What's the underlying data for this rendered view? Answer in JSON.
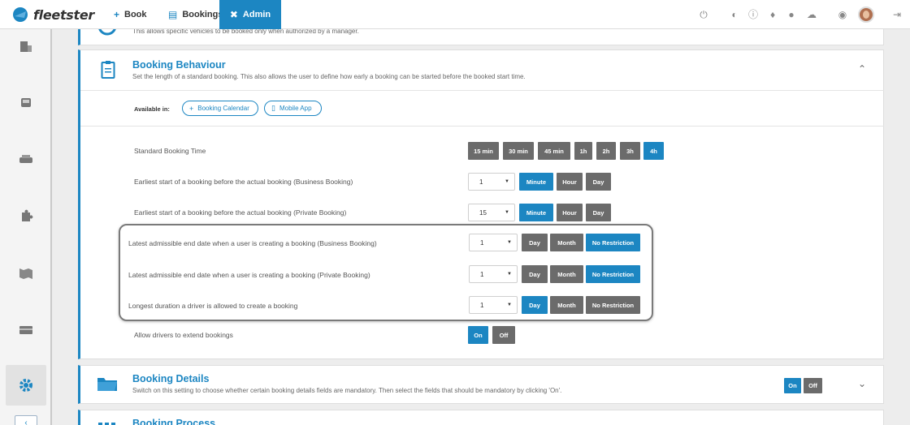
{
  "app": {
    "name": "fleetster",
    "brand_color": "#1c86c2"
  },
  "topnav": {
    "book": "Book",
    "bookings": "Bookings",
    "admin": "Admin"
  },
  "top_card": {
    "desc": "This allows specific vehicles to be booked only when authorized by a manager."
  },
  "booking_behaviour": {
    "title": "Booking Behaviour",
    "desc": "Set the length of a standard booking. This also allows the user to define how early a booking can be started before the booked start time.",
    "available_in_label": "Available in:",
    "available_in": [
      "Booking Calendar",
      "Mobile App"
    ],
    "rows": {
      "standard_time": {
        "label": "Standard Booking Time",
        "options": [
          "15 min",
          "30 min",
          "45 min",
          "1h",
          "2h",
          "3h",
          "4h"
        ],
        "selected": "4h"
      },
      "earliest_business": {
        "label": "Earliest start of a booking before the actual booking (Business Booking)",
        "value": "1",
        "units": [
          "Minute",
          "Hour",
          "Day"
        ],
        "selected": "Minute"
      },
      "earliest_private": {
        "label": "Earliest start of a booking before the actual booking (Private Booking)",
        "value": "15",
        "units": [
          "Minute",
          "Hour",
          "Day"
        ],
        "selected": "Minute"
      },
      "latest_business": {
        "label": "Latest admissible end date when a user is creating a booking (Business Booking)",
        "value": "1",
        "units": [
          "Day",
          "Month",
          "No Restriction"
        ],
        "selected": "No Restriction"
      },
      "latest_private": {
        "label": "Latest admissible end date when a user is creating a booking (Private Booking)",
        "value": "1",
        "units": [
          "Day",
          "Month",
          "No Restriction"
        ],
        "selected": "No Restriction"
      },
      "longest_duration": {
        "label": "Longest duration a driver is allowed to create a booking",
        "value": "1",
        "units": [
          "Day",
          "Month",
          "No Restriction"
        ],
        "selected": "Day"
      },
      "extend": {
        "label": "Allow drivers to extend bookings",
        "options": [
          "On",
          "Off"
        ],
        "selected": "On"
      }
    }
  },
  "booking_details": {
    "title": "Booking Details",
    "desc": "Switch on this setting to choose whether certain booking details fields are mandatory. Then select the fields that should be mandatory by clicking 'On'.",
    "on": "On",
    "off": "Off",
    "selected": "On"
  },
  "booking_process": {
    "title": "Booking Process"
  }
}
